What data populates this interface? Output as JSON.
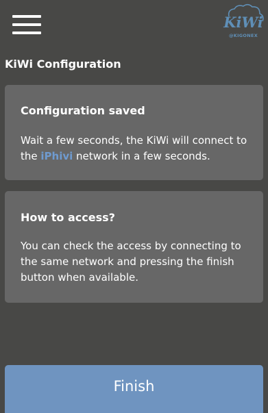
{
  "header": {
    "logo_text": "KiWi",
    "logo_subtitle": "@KIGONEX"
  },
  "page": {
    "title": "KiWi Configuration"
  },
  "cards": [
    {
      "title": "Configuration saved",
      "text_before": "Wait a few seconds, the KiWi will connect to the ",
      "network_name": "iPhivi",
      "text_after": " network in a few seconds."
    },
    {
      "title": "How to access?",
      "text": "You can check the access by connecting to the same network and pressing the finish button when available."
    }
  ],
  "footer": {
    "finish_label": "Finish"
  },
  "colors": {
    "background": "#484846",
    "card": "#676767",
    "accent": "#6f9bd0",
    "button": "#6f94c0",
    "logo": "#5f8fb7"
  }
}
